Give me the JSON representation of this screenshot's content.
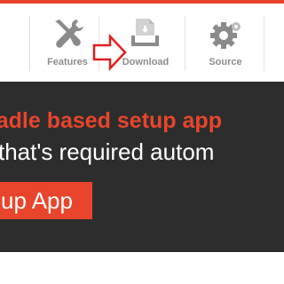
{
  "nav": {
    "items": [
      {
        "label": "Features",
        "icon": "tools-icon"
      },
      {
        "label": "Download",
        "icon": "download-tray-icon"
      },
      {
        "label": "Source",
        "icon": "gear-icon"
      }
    ],
    "annotation_arrow": "right-arrow-outline"
  },
  "hero": {
    "title": "radle based setup app",
    "subtitle": "that's required autom",
    "button_label": "up App"
  },
  "colors": {
    "accent": "#e8452c",
    "hero_background": "#2d2d2d",
    "nav_label": "#8c8c8c",
    "icon_gray": "#8a8a8a"
  }
}
